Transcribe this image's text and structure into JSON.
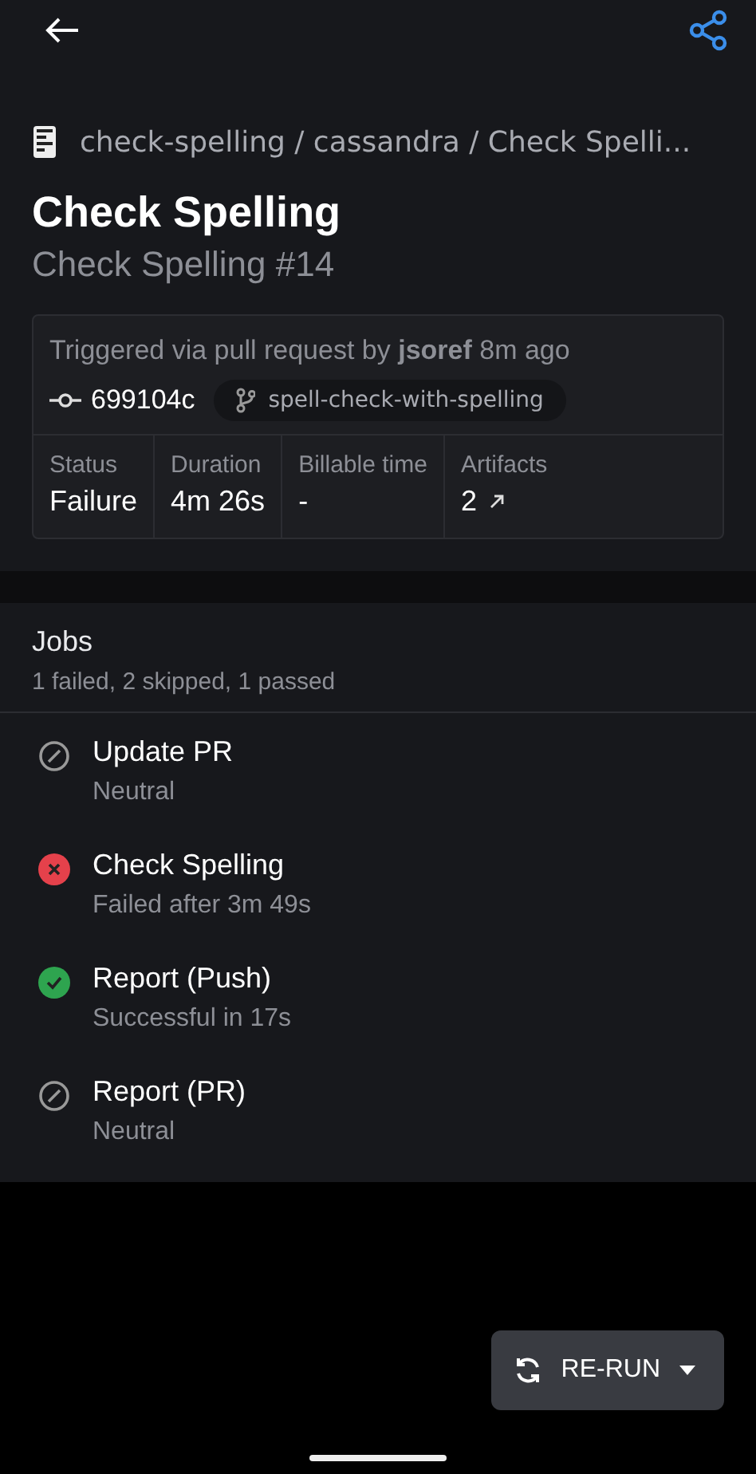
{
  "breadcrumb": "check-spelling / cassandra / Check Spelli...",
  "title": "Check Spelling",
  "subtitle": "Check Spelling #14",
  "summary": {
    "trigger": "Triggered via pull request by **jsoref** 8m ago",
    "commit": "699104c",
    "branch": "spell-check-with-spelling",
    "stats": [
      {
        "label": "Status",
        "value": "Failure",
        "kind": "text"
      },
      {
        "label": "Duration",
        "value": "4m 26s",
        "kind": "text"
      },
      {
        "label": "Billable time",
        "value": "-",
        "kind": "text"
      },
      {
        "label": "Artifacts",
        "value": "2",
        "kind": "link"
      }
    ]
  },
  "jobs": {
    "title": "Jobs",
    "summary": "1 failed, 2 skipped, 1 passed",
    "items": [
      {
        "name": "Update PR",
        "detail": "Neutral",
        "kind": "neutral"
      },
      {
        "name": "Check Spelling",
        "detail": "Failed after 3m 49s",
        "kind": "failure"
      },
      {
        "name": "Report (Push)",
        "detail": "Successful in 17s",
        "kind": "success"
      },
      {
        "name": "Report (PR)",
        "detail": "Neutral",
        "kind": "neutral"
      }
    ]
  },
  "rerun_button": "RE-RUN"
}
